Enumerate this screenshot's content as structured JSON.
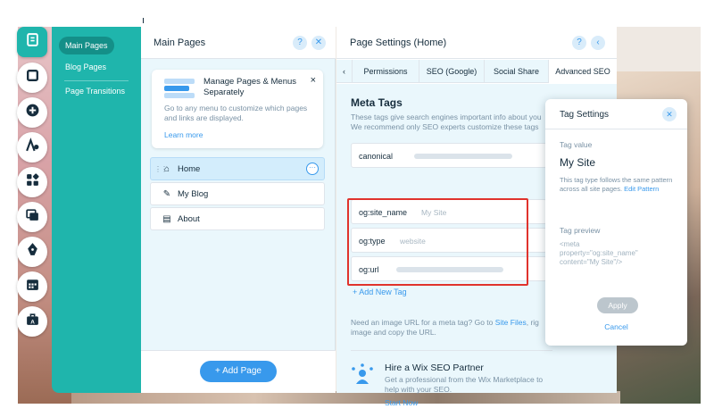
{
  "submenu": {
    "items": [
      {
        "label": "Main Pages"
      },
      {
        "label": "Blog Pages"
      },
      {
        "label": "Page Transitions"
      }
    ]
  },
  "main_pages": {
    "title": "Main Pages",
    "help": "?",
    "close": "✕",
    "tip": {
      "title": "Manage Pages & Menus Separately",
      "text": "Go to any menu to customize which pages and links are displayed.",
      "link": "Learn more",
      "close": "×"
    },
    "pages": [
      {
        "label": "Home",
        "icon": "⌂"
      },
      {
        "label": "My Blog",
        "icon": "✎"
      },
      {
        "label": "About",
        "icon": "▤"
      }
    ],
    "more": "···",
    "add_button": "+ Add Page"
  },
  "page_settings": {
    "title": "Page Settings (Home)",
    "help": "?",
    "back": "‹",
    "tab_back": "‹",
    "tabs": [
      "Permissions",
      "SEO (Google)",
      "Social Share",
      "Advanced SEO"
    ],
    "meta_title": "Meta Tags",
    "meta_desc_1": "These tags give search engines important info about you",
    "meta_desc_2": "We recommend only SEO experts customize these tags",
    "tags": [
      {
        "key": "canonical",
        "value": ""
      },
      {
        "key": "og:site_name",
        "value": "My Site"
      },
      {
        "key": "og:type",
        "value": "website"
      },
      {
        "key": "og:url",
        "value": ""
      }
    ],
    "add_tag": "+ Add New Tag",
    "hint_pre": "Need an image URL for a meta tag? Go to ",
    "hint_link": "Site Files",
    "hint_post": ", rig",
    "hint_line2": "image and copy the URL.",
    "partner_title": "Hire a Wix SEO Partner",
    "partner_desc": "Get a professional from the Wix Marketplace to help with your SEO.",
    "partner_link": "Start Now"
  },
  "tag_settings": {
    "title": "Tag Settings",
    "close": "✕",
    "value_label": "Tag value",
    "value": "My Site",
    "note_pre": "This tag type follows the same pattern across all site pages. ",
    "note_link": "Edit Pattern",
    "preview_label": "Tag preview",
    "preview_l1": "<meta",
    "preview_l2": "property=\"og:site_name\"",
    "preview_l3": "content=\"My Site\"/>",
    "apply": "Apply",
    "cancel": "Cancel"
  },
  "colors": {
    "teal": "#1fb5ac",
    "blue": "#3899ec",
    "highlight": "#e0332d"
  }
}
